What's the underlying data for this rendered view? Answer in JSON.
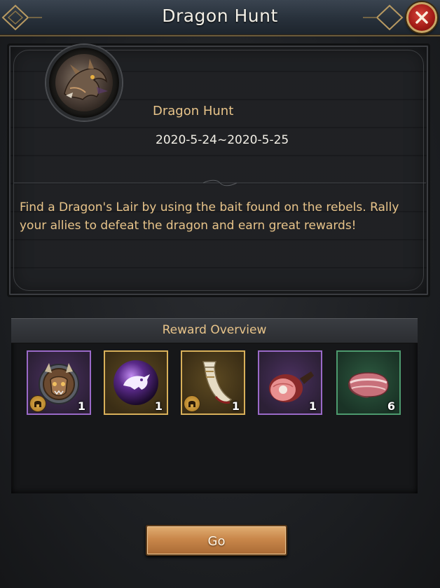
{
  "window": {
    "title": "Dragon Hunt",
    "close_icon": "close-icon"
  },
  "event": {
    "name": "Dragon Hunt",
    "dates": "2020-5-24~2020-5-25",
    "avatar_icon": "dragon-portrait-icon",
    "description": "Find a Dragon's Lair by using the bait found on the rebels. Rally your allies to defeat the dragon and earn great rewards!"
  },
  "rewards": {
    "header": "Reward Overview",
    "items": [
      {
        "icon": "dragon-helm-icon",
        "rarity": "purple",
        "quantity": "1",
        "has_badge": true
      },
      {
        "icon": "dragon-orb-icon",
        "rarity": "gold",
        "quantity": "1",
        "has_badge": false
      },
      {
        "icon": "war-horn-icon",
        "rarity": "gold",
        "quantity": "1",
        "has_badge": true
      },
      {
        "icon": "ham-leg-icon",
        "rarity": "purple",
        "quantity": "1",
        "has_badge": false
      },
      {
        "icon": "raw-meat-icon",
        "rarity": "green",
        "quantity": "6",
        "has_badge": false
      }
    ]
  },
  "actions": {
    "go_label": "Go"
  },
  "colors": {
    "accent_gold": "#e8c48a",
    "close_red": "#c1271f",
    "button_orange": "#c9874a"
  }
}
